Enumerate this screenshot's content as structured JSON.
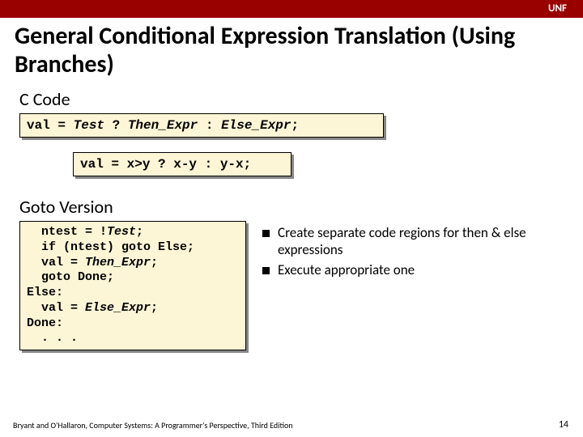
{
  "topbar": {
    "label": "UNF"
  },
  "title": "General Conditional Expression Translation (Using Branches)",
  "sections": {
    "ccode": "C Code",
    "goto": "Goto Version"
  },
  "code": {
    "expr_prefix": "val = ",
    "expr_test": "Test",
    "expr_q": " ? ",
    "expr_then": "Then_Expr",
    "expr_colon": " : ",
    "expr_else": "Else_Expr",
    "expr_semi": ";",
    "example": "val = x>y ? x-y : y-x;",
    "goto_l1a": "  ntest = !",
    "goto_l1b": "Test",
    "goto_l1c": ";",
    "goto_l2": "  if (ntest) goto Else;",
    "goto_l3a": "  val = ",
    "goto_l3b": "Then_Expr",
    "goto_l3c": ";",
    "goto_l4": "  goto Done;",
    "goto_l5": "Else:",
    "goto_l6a": "  val = ",
    "goto_l6b": "Else_Expr",
    "goto_l6c": ";",
    "goto_l7": "Done:",
    "goto_l8": "  . . ."
  },
  "bullets": {
    "b1": "Create separate code regions for then & else expressions",
    "b2": "Execute appropriate one"
  },
  "footer": "Bryant and O'Hallaron, Computer Systems: A Programmer's Perspective, Third Edition",
  "page": "14"
}
